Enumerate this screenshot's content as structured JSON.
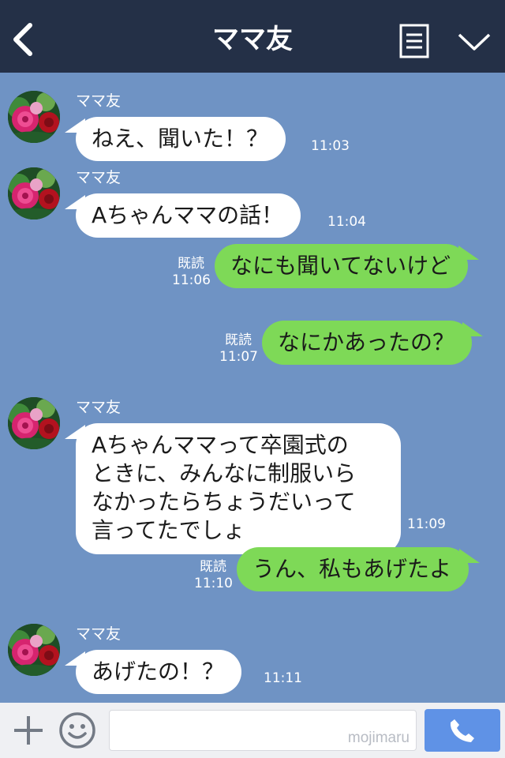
{
  "header": {
    "title": "ママ友"
  },
  "messages": [
    {
      "type": "in",
      "sender": "ママ友",
      "text": "ねえ、聞いた！？",
      "time": "11:03"
    },
    {
      "type": "in",
      "sender": "ママ友",
      "text": "Aちゃんママの話！",
      "time": "11:04"
    },
    {
      "type": "out",
      "read": "既読",
      "time": "11:06",
      "text": "なにも聞いてないけど"
    },
    {
      "type": "out",
      "read": "既読",
      "time": "11:07",
      "text": "なにかあったの？"
    },
    {
      "type": "in",
      "sender": "ママ友",
      "lines": [
        "Aちゃんママって卒園式の",
        "ときに、みんなに制服いら",
        "なかったらちょうだいって",
        "言ってたでしょ"
      ],
      "time": "11:09"
    },
    {
      "type": "out",
      "read": "既読",
      "time": "11:10",
      "text": "うん、私もあげたよ"
    },
    {
      "type": "in",
      "sender": "ママ友",
      "text": "あげたの！？",
      "time": "11:11"
    }
  ],
  "input": {
    "watermark": "mojimaru"
  },
  "icons": {
    "back": "back-arrow-icon",
    "menu": "list-menu-icon",
    "chevron": "chevron-down-icon",
    "plus": "plus-icon",
    "emoji": "smiley-icon",
    "call": "phone-icon",
    "avatar": "rose-avatar"
  },
  "colors": {
    "background": "#6f93c4",
    "header": "#243047",
    "incoming_bubble": "#ffffff",
    "outgoing_bubble": "#7ed957",
    "call_button": "#5f92e6"
  }
}
